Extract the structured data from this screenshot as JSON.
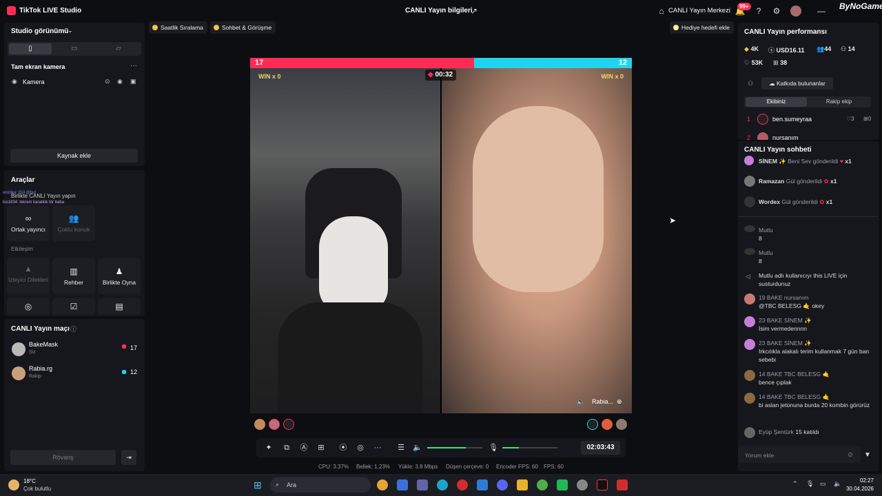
{
  "titlebar": {
    "app_title": "TikTok LIVE Studio",
    "center_title": "CANLI Yayın bilgileri",
    "live_center": "CANLI Yayın Merkezi",
    "notif_badge": "99+",
    "brand": "ByNoGame"
  },
  "left": {
    "studio_view": "Studio görünümü",
    "scene_title": "Tam ekran kamera",
    "camera_label": "Kamera",
    "add_source": "Kaynak ekle",
    "tools_title": "Araçlar",
    "tools_hint": "Birlikte CANLI Yayın yapın",
    "overlay_lines": [
      "wordex: Gül @bul",
      "lco1834: lekrem karabük tör baba"
    ],
    "co_host": "Ortak yayıncı",
    "multi_guest": "Çoklu konuk",
    "interaction": "Etkileşim",
    "viewer_requests": "İzleyici Dilekleri",
    "guide": "Rehber",
    "play_together": "Birlikte Oyna",
    "match_title": "CANLI Yayın maçı",
    "players": [
      {
        "name": "BakeMask",
        "sub": "Siz",
        "score": "17"
      },
      {
        "name": "Rabia.rg",
        "sub": "Rakip",
        "score": "12"
      }
    ],
    "rematch": "Rövanş"
  },
  "pills": {
    "hourly": "Saatlik Sıralama",
    "chat_meet": "Sohbet & Görüşme",
    "gift_goal": "Hediye hedefi ekle"
  },
  "battle": {
    "score_left": "17",
    "score_right": "12",
    "win_left": "WIN x 0",
    "win_right": "WIN x 0",
    "timer": "00:32",
    "opponent_tag": "Rabia...",
    "left_bar_fraction": 0.586
  },
  "controls": {
    "duration": "02:03:43"
  },
  "stats": {
    "cpu": "CPU: 3.37%",
    "memory": "Bellek: 1.23%",
    "upload": "Yükle: 3.8 Mbps",
    "dropped": "Düşen çerçeve: 0",
    "encoder_fps": "Encoder FPS: 60",
    "fps": "FPS: 60"
  },
  "right": {
    "perf_title": "CANLI Yayın performansı",
    "diamonds": "4K",
    "usd": "USD16.11",
    "viewers": "44",
    "followers": "14",
    "likes": "53K",
    "gifts": "38",
    "contributors": "Katkıda bulunanlar",
    "tab_ours": "Ekibiniz",
    "tab_rival": "Rakip ekip",
    "rank1_no": "1",
    "rank1_name": "ben.sumeyraa",
    "rank1_likes": "3",
    "rank1_gifts": "0",
    "rank2_no": "2",
    "rank2_name": "nursanım",
    "chat_title": "CANLI Yayın sohbeti",
    "gifts_feed": [
      {
        "user": "SİNEM ✨",
        "text": "Beni Sev gönderildi",
        "count": "x1"
      },
      {
        "user": "Ramazan",
        "text": "Gül gönderildi",
        "count": "x1"
      },
      {
        "user": "Wordex",
        "text": "Gül gönderildi",
        "count": "x1"
      }
    ],
    "chat": [
      {
        "user": "Mutlu",
        "text": "8"
      },
      {
        "user": "Mutlu",
        "text": "8"
      },
      {
        "user": "",
        "text": "Mutlu adlı kullanıcıyı this LIVE için susturdunuz"
      },
      {
        "user": "19 BAKE nursanım",
        "text": "@TBC BELESG 🤙 okey"
      },
      {
        "user": "23 BAKE SİNEM ✨",
        "text": "İsim vermedennnn"
      },
      {
        "user": "23 BAKE SİNEM ✨",
        "text": "Irkcılıkla alakalı terim kullanmak 7 gün ban sebebi"
      },
      {
        "user": "14 BAKE TBC BELESG 🤙",
        "text": "bence çıplak"
      },
      {
        "user": "14 BAKE TBC BELESG 🤙",
        "text": "bi aslan jetonuna burda 20 kombin görürüz"
      },
      {
        "user": "Eyüp Şentürk",
        "text": "15 katıldı"
      }
    ],
    "comment_placeholder": "Yorum ekle"
  },
  "taskbar": {
    "temp": "18°C",
    "weather": "Çok bulutlu",
    "search": "Ara",
    "time": "02:27",
    "date": "30.04.2026"
  },
  "colors": {
    "accent": "#fe2c55",
    "rival": "#22d3ee"
  }
}
